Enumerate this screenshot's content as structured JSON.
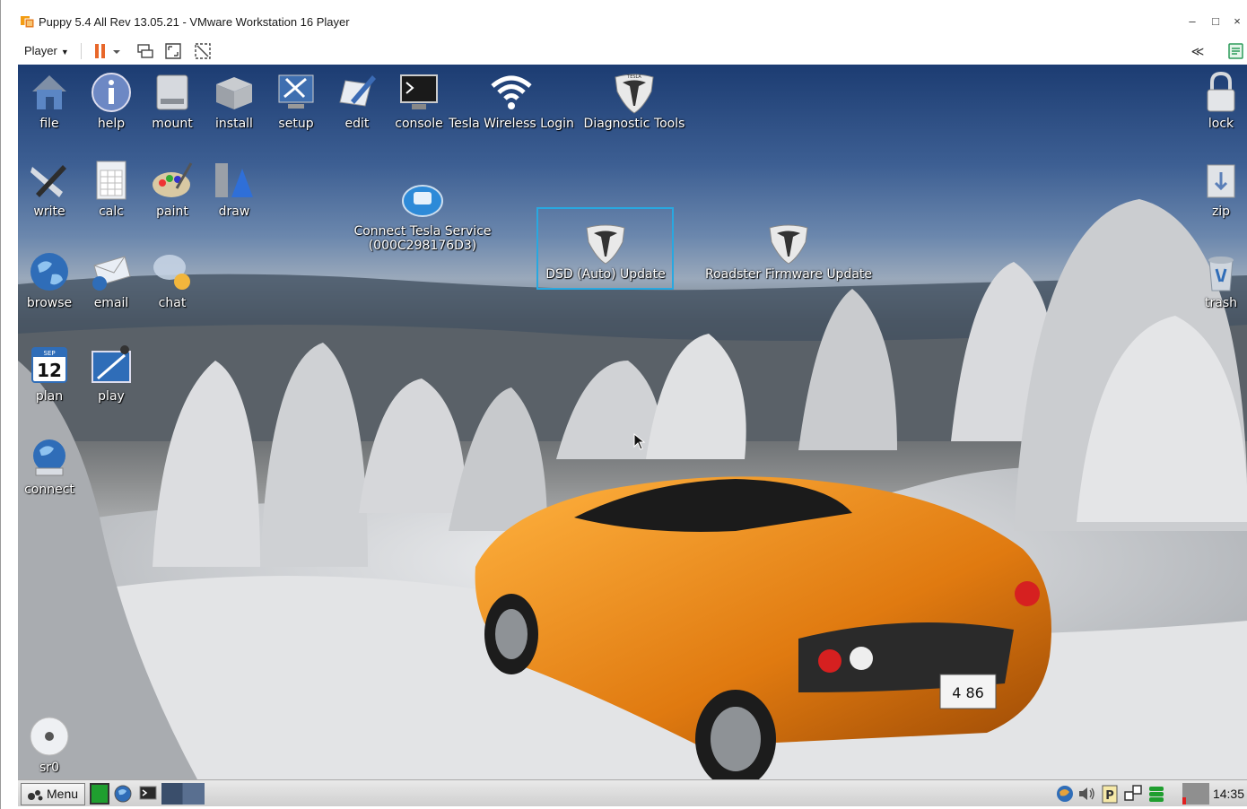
{
  "window": {
    "title": "Puppy 5.4 All Rev 13.05.21 - VMware Workstation 16 Player",
    "controls": {
      "minimize": "–",
      "maximize": "□",
      "close": "×"
    }
  },
  "toolbar": {
    "player_label": "Player",
    "icons": [
      "pause-icon",
      "send-ctrl-alt-del-icon",
      "full-screen-icon",
      "unity-icon",
      "collapse-icon",
      "message-log-icon"
    ]
  },
  "desktop": {
    "icons_top_row": [
      {
        "label": "file",
        "icon": "home-folder-icon"
      },
      {
        "label": "help",
        "icon": "info-icon"
      },
      {
        "label": "mount",
        "icon": "drive-icon"
      },
      {
        "label": "install",
        "icon": "package-icon"
      },
      {
        "label": "setup",
        "icon": "tools-icon"
      },
      {
        "label": "edit",
        "icon": "pen-icon"
      },
      {
        "label": "console",
        "icon": "terminal-icon"
      },
      {
        "label": "Tesla Wireless Login",
        "icon": "wifi-icon"
      },
      {
        "label": "Diagnostic Tools",
        "icon": "tesla-logo-icon"
      }
    ],
    "icons_row2": [
      {
        "label": "write",
        "icon": "write-icon"
      },
      {
        "label": "calc",
        "icon": "calculator-icon"
      },
      {
        "label": "paint",
        "icon": "palette-icon"
      },
      {
        "label": "draw",
        "icon": "draw-shapes-icon"
      }
    ],
    "icons_row3": [
      {
        "label": "browse",
        "icon": "globe-icon"
      },
      {
        "label": "email",
        "icon": "email-icon"
      },
      {
        "label": "chat",
        "icon": "chat-bubble-icon"
      }
    ],
    "icons_row4": [
      {
        "label": "plan",
        "icon": "calendar-icon",
        "calendar_month": "SEP",
        "calendar_day": "12"
      },
      {
        "label": "play",
        "icon": "media-player-icon"
      }
    ],
    "connect": {
      "label": "connect",
      "icon": "network-globe-icon"
    },
    "sr0": {
      "label": "sr0",
      "icon": "cd-drive-icon"
    },
    "right_column": [
      {
        "label": "lock",
        "icon": "padlock-icon"
      },
      {
        "label": "zip",
        "icon": "zip-archive-icon"
      },
      {
        "label": "trash",
        "icon": "trash-bin-icon"
      }
    ],
    "tesla_service": {
      "label_line1": "Connect Tesla Service",
      "label_line2": "(000C298176D3)",
      "icon": "telephone-icon"
    },
    "dsd_update": {
      "label": "DSD (Auto) Update",
      "icon": "tesla-logo-icon",
      "selected": true
    },
    "roadster_update": {
      "label": "Roadster Firmware Update",
      "icon": "tesla-logo-icon"
    },
    "tesla_badge_text": "TESLA",
    "plate_text": "4 86"
  },
  "taskbar": {
    "menu_label": "Menu",
    "clock": "14:35",
    "colors": {
      "accent_green": "#1f9e2f",
      "battery_red": "#e02020"
    }
  }
}
